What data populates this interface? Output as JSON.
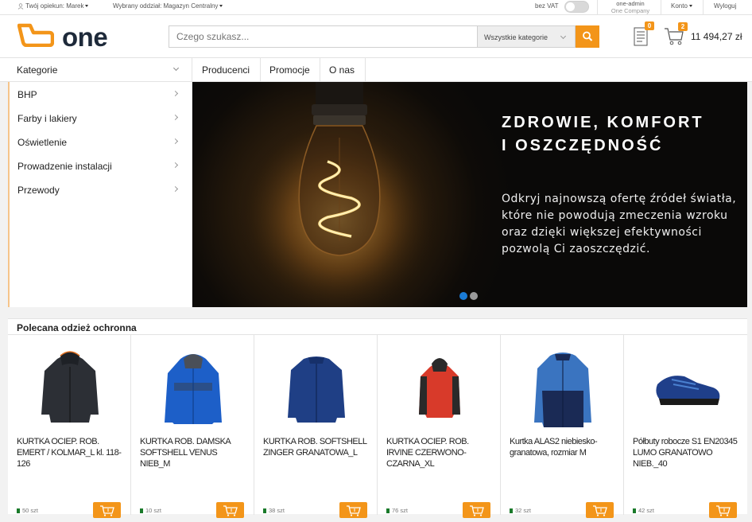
{
  "topbar": {
    "guardian_label": "Twój opiekun: Marek",
    "branch_label": "Wybrany oddział: Magazyn Centralny",
    "vat_label": "bez VAT",
    "vat_toggle_on": false,
    "account_user": "one-admin",
    "account_company": "One Company",
    "konto_label": "Konto",
    "logout_label": "Wyloguj"
  },
  "header": {
    "logo_text": "one",
    "search_placeholder": "Czego szukasz...",
    "category_select": "Wszystkie kategorie",
    "list_badge": "0",
    "cart_badge": "2",
    "cart_total": "11 494,27 zł"
  },
  "colors": {
    "accent": "#f39519",
    "logo_dark": "#1e2a3a",
    "stock_green": "#1a7a2a"
  },
  "nav": {
    "categories_label": "Kategorie",
    "links": [
      "Producenci",
      "Promocje",
      "O nas"
    ]
  },
  "categories": [
    "BHP",
    "Farby i lakiery",
    "Oświetlenie",
    "Prowadzenie instalacji",
    "Przewody"
  ],
  "banner": {
    "title_line1": "ZDROWIE, KOMFORT",
    "title_line2": "I OSZCZĘDNOŚĆ",
    "text_lines": [
      "Odkryj najnowszą ofertę źródeł światła,",
      "które nie powodują zmeczenia wzroku",
      "oraz dzięki większej efektywności",
      "pozwolą Ci zaoszczędzić."
    ],
    "slides": 2,
    "active_slide": 1
  },
  "products_section": {
    "title": "Polecana odzież ochronna",
    "items": [
      {
        "name": "KURTKA OCIEP. ROB. EMERT / KOLMAR_L kl. 118-126",
        "stock": "50 szt",
        "icon": "dark-jacket-image"
      },
      {
        "name": "KURTKA ROB. DAMSKA SOFTSHELL VENUS NIEB_M",
        "stock": "10 szt",
        "icon": "blue-softshell-jacket-image"
      },
      {
        "name": "KURTKA ROB. SOFTSHELL ZINGER GRANATOWA_L",
        "stock": "38 szt",
        "icon": "navy-softshell-jacket-image"
      },
      {
        "name": "KURTKA OCIEP. ROB. IRVINE CZERWONO-CZARNA_XL",
        "stock": "76 szt",
        "icon": "red-black-jacket-image"
      },
      {
        "name": "Kurtka ALAS2 niebiesko-granatowa, rozmiar M",
        "stock": "32 szt",
        "icon": "blue-navy-jacket-image"
      },
      {
        "name": "Półbuty robocze S1 EN20345 LUMO GRANATOWO NIEB._40",
        "stock": "42 szt",
        "icon": "work-shoes-image"
      }
    ]
  }
}
